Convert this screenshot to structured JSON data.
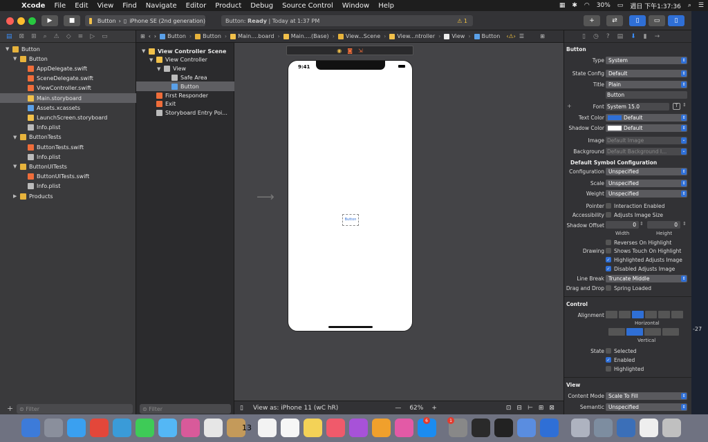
{
  "menubar": {
    "app": "Xcode",
    "items": [
      "File",
      "Edit",
      "View",
      "Find",
      "Navigate",
      "Editor",
      "Product",
      "Debug",
      "Source Control",
      "Window",
      "Help"
    ],
    "battery": "30%",
    "clock": "週日 下午1:37:36"
  },
  "toolbar": {
    "scheme_target": "Button",
    "scheme_device": "iPhone SE (2nd generation)",
    "status_prefix": "Button:",
    "status_state": "Ready",
    "status_time": "Today at 1:37 PM",
    "warning_count": "1"
  },
  "navigator": {
    "rows": [
      {
        "label": "Button",
        "icon": "folder",
        "indent": 0,
        "disclosure": "open",
        "selected": false
      },
      {
        "label": "Button",
        "icon": "folder",
        "indent": 1,
        "disclosure": "open",
        "selected": false
      },
      {
        "label": "AppDelegate.swift",
        "icon": "swift",
        "indent": 2,
        "disclosure": "",
        "selected": false
      },
      {
        "label": "SceneDelegate.swift",
        "icon": "swift",
        "indent": 2,
        "disclosure": "",
        "selected": false
      },
      {
        "label": "ViewController.swift",
        "icon": "swift",
        "indent": 2,
        "disclosure": "",
        "selected": false
      },
      {
        "label": "Main.storyboard",
        "icon": "sb",
        "indent": 2,
        "disclosure": "",
        "selected": true
      },
      {
        "label": "Assets.xcassets",
        "icon": "assets",
        "indent": 2,
        "disclosure": "",
        "selected": false
      },
      {
        "label": "LaunchScreen.storyboard",
        "icon": "sb",
        "indent": 2,
        "disclosure": "",
        "selected": false
      },
      {
        "label": "Info.plist",
        "icon": "plist",
        "indent": 2,
        "disclosure": "",
        "selected": false
      },
      {
        "label": "ButtonTests",
        "icon": "folder",
        "indent": 1,
        "disclosure": "open",
        "selected": false
      },
      {
        "label": "ButtonTests.swift",
        "icon": "swift",
        "indent": 2,
        "disclosure": "",
        "selected": false
      },
      {
        "label": "Info.plist",
        "icon": "plist",
        "indent": 2,
        "disclosure": "",
        "selected": false
      },
      {
        "label": "ButtonUITests",
        "icon": "folder",
        "indent": 1,
        "disclosure": "open",
        "selected": false
      },
      {
        "label": "ButtonUITests.swift",
        "icon": "swift",
        "indent": 2,
        "disclosure": "",
        "selected": false
      },
      {
        "label": "Info.plist",
        "icon": "plist",
        "indent": 2,
        "disclosure": "",
        "selected": false
      },
      {
        "label": "Products",
        "icon": "folder",
        "indent": 1,
        "disclosure": "closed",
        "selected": false
      }
    ],
    "filter_placeholder": "Filter"
  },
  "outline": {
    "rows": [
      {
        "label": "View Controller Scene",
        "icon": "sb",
        "indent": 0,
        "disclosure": "open",
        "selected": false,
        "bold": true
      },
      {
        "label": "View Controller",
        "icon": "sb",
        "indent": 1,
        "disclosure": "open",
        "selected": false,
        "bold": false
      },
      {
        "label": "View",
        "icon": "plist",
        "indent": 2,
        "disclosure": "open",
        "selected": false,
        "bold": false
      },
      {
        "label": "Safe Area",
        "icon": "plist",
        "indent": 3,
        "disclosure": "",
        "selected": false,
        "bold": false
      },
      {
        "label": "Button",
        "icon": "assets",
        "indent": 3,
        "disclosure": "",
        "selected": true,
        "bold": false
      },
      {
        "label": "First Responder",
        "icon": "swift",
        "indent": 1,
        "disclosure": "",
        "selected": false,
        "bold": false
      },
      {
        "label": "Exit",
        "icon": "swift",
        "indent": 1,
        "disclosure": "",
        "selected": false,
        "bold": false
      },
      {
        "label": "Storyboard Entry Poi...",
        "icon": "plist",
        "indent": 1,
        "disclosure": "",
        "selected": false,
        "bold": false
      }
    ],
    "filter_placeholder": "Filter"
  },
  "jumpbar": {
    "crumbs": [
      "Button",
      "Button",
      "Main....board",
      "Main....(Base)",
      "View...Scene",
      "View...ntroller",
      "View",
      "Button"
    ]
  },
  "canvas": {
    "phone_time": "9:41",
    "view_as": "View as: iPhone 11 (wC hR)",
    "zoom": "62%"
  },
  "inspector": {
    "section_button": "Button",
    "type_label": "Type",
    "type_value": "System",
    "state_config_label": "State Config",
    "state_config_value": "Default",
    "title_label": "Title",
    "title_value": "Plain",
    "title_text": "Button",
    "font_label": "Font",
    "font_value": "System 15.0",
    "text_color_label": "Text Color",
    "text_color_value": "Default",
    "shadow_color_label": "Shadow Color",
    "shadow_color_value": "Default",
    "image_label": "Image",
    "image_placeholder": "Default Image",
    "background_label": "Background",
    "background_placeholder": "Default Background I...",
    "symbol_section": "Default Symbol Configuration",
    "configuration_label": "Configuration",
    "configuration_value": "Unspecified",
    "scale_label": "Scale",
    "scale_value": "Unspecified",
    "weight_label": "Weight",
    "weight_value": "Unspecified",
    "pointer_label": "Pointer",
    "pointer_cb": "Interaction Enabled",
    "accessibility_label": "Accessibility",
    "accessibility_cb": "Adjusts Image Size",
    "shadow_offset_label": "Shadow Offset",
    "shadow_w": "0",
    "shadow_h": "0",
    "width_label": "Width",
    "height_label": "Height",
    "reverses_cb": "Reverses On Highlight",
    "drawing_label": "Drawing",
    "shows_touch_cb": "Shows Touch On Highlight",
    "highlighted_adjusts_cb": "Highlighted Adjusts Image",
    "disabled_adjusts_cb": "Disabled Adjusts Image",
    "line_break_label": "Line Break",
    "line_break_value": "Truncate Middle",
    "drag_drop_label": "Drag and Drop",
    "spring_loaded_cb": "Spring Loaded",
    "section_control": "Control",
    "alignment_label": "Alignment",
    "horizontal_label": "Horizontal",
    "vertical_label": "Vertical",
    "state_label": "State",
    "selected_cb": "Selected",
    "enabled_cb": "Enabled",
    "highlighted_cb": "Highlighted",
    "section_view": "View",
    "content_mode_label": "Content Mode",
    "content_mode_value": "Scale To Fill",
    "semantic_label": "Semantic",
    "semantic_value": "Unspecified"
  },
  "desktop": {
    "edge_text": "-27"
  },
  "colors": {
    "accent": "#2f6fd6",
    "xcode_dark": "#2c2c2e",
    "selection": "#5e5e62"
  },
  "dock": {
    "calendar_day": "13",
    "badges": [
      "6",
      "1"
    ]
  }
}
